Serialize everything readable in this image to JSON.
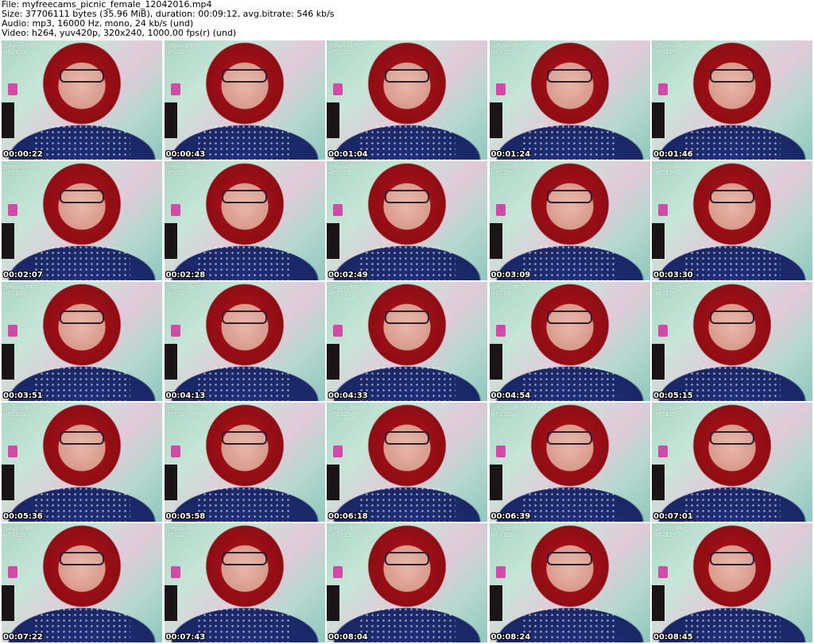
{
  "header": {
    "file": "File: myfreecams_picnic_female_12042016.mp4",
    "size": "Size: 37706111 bytes (35.96 MiB), duration: 00:09:12, avg.bitrate: 546 kb/s",
    "audio": "Audio: mp3, 16000 Hz, mono, 24 kb/s (und)",
    "video": "Video: h264, yuv420p, 320x240, 1000.00 fps(r) (und)"
  },
  "thumbnails": [
    {
      "watermark_1": "@PicnicMFC",
      "watermark_2": "HT=125",
      "timestamp": "00:00:22"
    },
    {
      "watermark_1": "@PicnicMFC",
      "watermark_2": "HT=125",
      "timestamp": "00:00:43"
    },
    {
      "watermark_1": "@PicnicMFC",
      "watermark_2": "HT=125",
      "timestamp": "00:01:04"
    },
    {
      "watermark_1": "@PicnicMFC",
      "watermark_2": "HT=125",
      "timestamp": "00:01:24"
    },
    {
      "watermark_1": "@PicnicMFC",
      "watermark_2": "HT=125",
      "timestamp": "00:01:46"
    },
    {
      "watermark_1": "@PicnicMFC",
      "watermark_2": "HT=125",
      "timestamp": "00:02:07"
    },
    {
      "watermark_1": "@PicnicMFC",
      "watermark_2": "HT=125",
      "timestamp": "00:02:28"
    },
    {
      "watermark_1": "@PicnicMFC",
      "watermark_2": "HT=125",
      "timestamp": "00:02:49"
    },
    {
      "watermark_1": "@PicnicMFC",
      "watermark_2": "HT=125",
      "timestamp": "00:03:09"
    },
    {
      "watermark_1": "@PicnicMFC",
      "watermark_2": "HT=125",
      "timestamp": "00:03:30"
    },
    {
      "watermark_1": "@PicnicMFC",
      "watermark_2": "HT=125",
      "timestamp": "00:03:51"
    },
    {
      "watermark_1": "@PicnicMFC",
      "watermark_2": "HT=125",
      "timestamp": "00:04:13"
    },
    {
      "watermark_1": "@PicnicMFC",
      "watermark_2": "HT=125",
      "timestamp": "00:04:33"
    },
    {
      "watermark_1": "@PicnicMFC",
      "watermark_2": "HT=125",
      "timestamp": "00:04:54"
    },
    {
      "watermark_1": "@PicnicMFC",
      "watermark_2": "HT=125",
      "timestamp": "00:05:15"
    },
    {
      "watermark_1": "@PicnicMFC",
      "watermark_2": "HT=125",
      "timestamp": "00:05:36"
    },
    {
      "watermark_1": "@PicnicMFC",
      "watermark_2": "HT=125",
      "timestamp": "00:05:58"
    },
    {
      "watermark_1": "@PicnicMFC",
      "watermark_2": "HT=125",
      "timestamp": "00:06:18"
    },
    {
      "watermark_1": "@PicnicMFC",
      "watermark_2": "HT=125",
      "timestamp": "00:06:39"
    },
    {
      "watermark_1": "@PicnicMFC",
      "watermark_2": "HT=125",
      "timestamp": "00:07:01"
    },
    {
      "watermark_1": "@PicnicMFC",
      "watermark_2": "HT=125",
      "timestamp": "00:07:22"
    },
    {
      "watermark_1": "@PicnicMFC",
      "watermark_2": "HT=125",
      "timestamp": "00:07:43"
    },
    {
      "watermark_1": "@PicnicMFC",
      "watermark_2": "HT=125",
      "timestamp": "00:08:04"
    },
    {
      "watermark_1": "@PicnicMFC",
      "watermark_2": "HT=125",
      "timestamp": "00:08:24"
    },
    {
      "watermark_1": "@PicnicMFC",
      "watermark_2": "HT=125",
      "timestamp": "00:08:45"
    }
  ]
}
